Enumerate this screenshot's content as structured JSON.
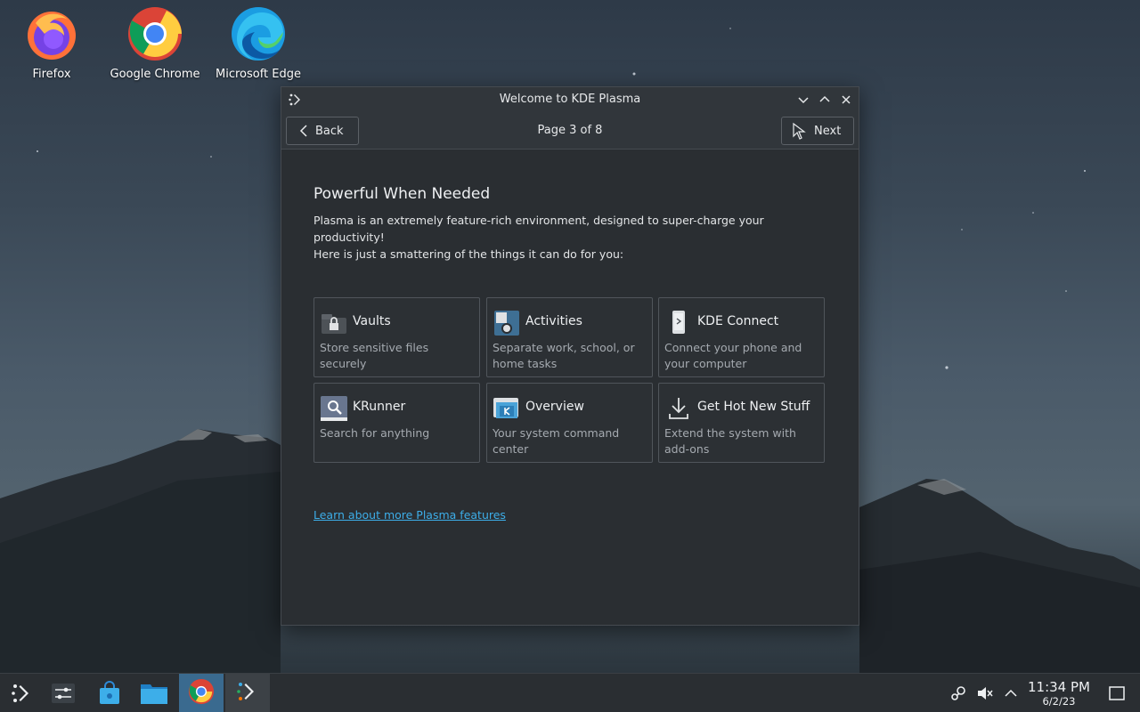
{
  "desktop": {
    "icons": [
      {
        "label": "Firefox",
        "icon": "firefox-icon"
      },
      {
        "label": "Google Chrome",
        "icon": "chrome-icon"
      },
      {
        "label": "Microsoft Edge",
        "icon": "edge-icon"
      }
    ]
  },
  "window": {
    "title": "Welcome to KDE Plasma",
    "app_icon": "kde-welcome-icon",
    "controls": [
      "minimize-icon",
      "maximize-icon",
      "close-icon"
    ]
  },
  "toolbar": {
    "back_label": "Back",
    "next_label": "Next",
    "page_indicator": "Page 3 of 8"
  },
  "page": {
    "heading": "Powerful When Needed",
    "description_line1": "Plasma is an extremely feature-rich environment, designed to super-charge your productivity!",
    "description_line2": "Here is just a smattering of the things it can do for you:",
    "cards": [
      {
        "title": "Vaults",
        "description": "Store sensitive files securely",
        "icon": "vault-icon"
      },
      {
        "title": "Activities",
        "description": "Separate work, school, or home tasks",
        "icon": "activities-icon"
      },
      {
        "title": "KDE Connect",
        "description": "Connect your phone and your computer",
        "icon": "kde-connect-icon"
      },
      {
        "title": "KRunner",
        "description": "Search for anything",
        "icon": "krunner-icon"
      },
      {
        "title": "Overview",
        "description": "Your system command center",
        "icon": "overview-icon"
      },
      {
        "title": "Get Hot New Stuff",
        "description": "Extend the system with add-ons",
        "icon": "download-icon"
      }
    ],
    "more_link": "Learn about more Plasma features"
  },
  "taskbar": {
    "items": [
      "app-launcher-icon",
      "settings-icon",
      "discover-icon",
      "files-icon",
      "chrome-icon",
      "kde-welcome-icon"
    ],
    "tray": [
      "steam-icon",
      "volume-muted-icon",
      "tray-expand-icon"
    ],
    "time": "11:34 PM",
    "date": "6/2/23",
    "show_desktop": "show-desktop-icon"
  },
  "colors": {
    "accent": "#3daee9",
    "window_bg": "#2a2e32",
    "titlebar_bg": "#31363b",
    "taskbar_active": "#3a6a8f"
  }
}
